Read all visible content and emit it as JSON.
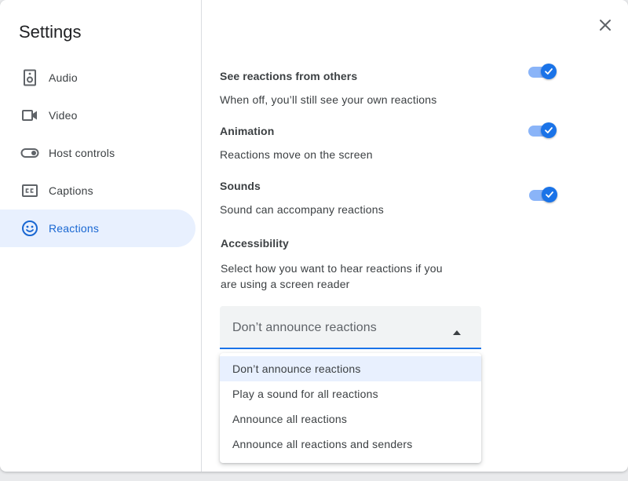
{
  "title": "Settings",
  "sidebar": {
    "items": [
      {
        "label": "Audio",
        "icon": "speaker-icon"
      },
      {
        "label": "Video",
        "icon": "video-camera-icon"
      },
      {
        "label": "Host controls",
        "icon": "toggle-icon"
      },
      {
        "label": "Captions",
        "icon": "closed-captions-icon"
      },
      {
        "label": "Reactions",
        "icon": "smiley-icon",
        "active": true
      }
    ]
  },
  "settings": {
    "see_reactions": {
      "title": "See reactions from others",
      "description": "When off, you’ll still see your own reactions",
      "enabled": true
    },
    "animation": {
      "title": "Animation",
      "description": "Reactions move on the screen",
      "enabled": true
    },
    "sounds": {
      "title": "Sounds",
      "description": "Sound can accompany reactions",
      "enabled": true
    },
    "accessibility": {
      "title": "Accessibility",
      "description_line1": "Select how you want to hear reactions if you",
      "description_line2": "are using a screen reader",
      "selected": "Don’t announce reactions",
      "options": [
        "Don’t announce reactions",
        "Play a sound for all reactions",
        "Announce all reactions",
        "Announce all reactions and senders"
      ]
    }
  },
  "colors": {
    "accent": "#1a73e8",
    "active_bg": "#e8f0fe",
    "active_text": "#1967d2",
    "toggle_track": "#8ab4f8"
  }
}
